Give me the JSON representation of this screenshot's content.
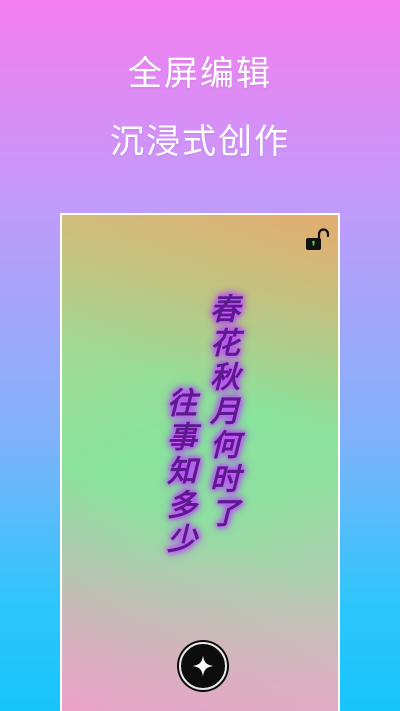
{
  "promo": {
    "headline_line1": "全屏编辑",
    "headline_line2": "沉浸式创作"
  },
  "editor": {
    "lock_icon": "unlocked-padlock-icon",
    "poem_columns": [
      "春花秋月何时了",
      "往事知多少"
    ],
    "poem_color": "#5b1a8e",
    "poem_glow_color": "#b838ff",
    "fab_icon": "sparkle-star-icon"
  },
  "colors": {
    "background_top": "#f57ef0",
    "background_bottom": "#17c4fc",
    "lock_accent": "#3ad64a"
  }
}
